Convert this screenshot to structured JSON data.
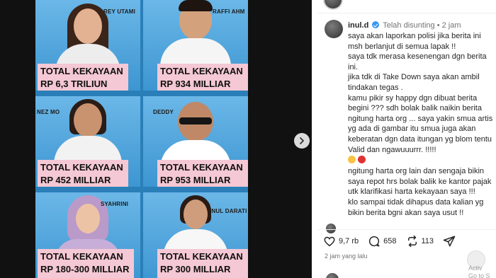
{
  "media": {
    "cells": [
      {
        "name": "REY UTAMI",
        "line1": "TOTAL KEKAYAAN",
        "line2": "RP 6,3 TRILIUN"
      },
      {
        "name": "RAFFI AHM",
        "line1": "TOTAL KEKAYAAN",
        "line2": "RP 934 MILLIAR"
      },
      {
        "name": "NEZ MO",
        "line1": "TOTAL KEKAYAAN",
        "line2": "RP 452 MILLIAR"
      },
      {
        "name": "DEDDY",
        "line1": "TOTAL KEKAYAAN",
        "line2": "RP 953 MILLIAR"
      },
      {
        "name": "SYAHRINI",
        "line1": "TOTAL KEKAYAAN",
        "line2": "RP 180-300 MILLIAR"
      },
      {
        "name": "INUL DARATI",
        "line1": "TOTAL KEKAYAAN",
        "line2": "RP 300 MILLIAR"
      }
    ],
    "next_icon": "chevron-right-icon"
  },
  "comment": {
    "username": "inul.d",
    "edited": "Telah disunting",
    "separator": "•",
    "time": "2 jam",
    "paragraph1": "saya akan laporkan polisi jika berita ini msh berlanjut di semua lapak !!",
    "paragraph2": "saya tdk merasa kesenengan dgn berita ini.",
    "paragraph3": "jika tdk di Take Down saya akan ambil tindakan tegas .",
    "paragraph4": "kamu pikir sy happy dgn dibuat berita begini ??? sdh bolak balik naikin berita ngitung harta org ... saya yakin smua artis yg ada di gambar itu smua juga akan keberatan dgn data itungan yg blom tentu Valid dan ngawuuurrr. !!!!!",
    "emoji": [
      "grinning-sweat-emoji",
      "angry-emoji"
    ],
    "paragraph5": "ngitung harta org lain dan sengaja bikin saya repot hrs bolak balik ke kantor pajak utk klarifikasi harta kekayaan saya !!!",
    "paragraph6": "klo sampai tidak dihapus data kalian yg bikin berita bgni akan saya usut !!"
  },
  "actions": {
    "likes": "9,7 rb",
    "comments": "658",
    "reposts": "113"
  },
  "time_ago": "2 jam yang lalu",
  "overlay": {
    "text": "Activ\nGo to S"
  },
  "colors": {
    "verified": "#3897f0",
    "tag_bg": "#f4c8d4",
    "image_bg": "#3d96d1"
  }
}
